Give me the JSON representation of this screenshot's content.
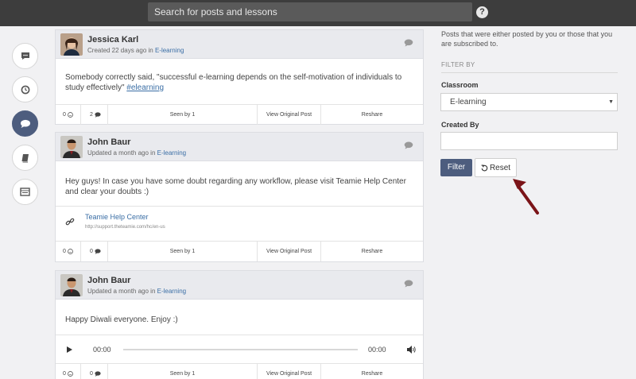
{
  "topbar": {
    "search_placeholder": "Search for posts and lessons",
    "help": "?"
  },
  "rail": [
    "comments-icon",
    "clock-icon",
    "chat-bubble-icon",
    "book-icon",
    "board-icon"
  ],
  "posts": [
    {
      "author": "Jessica Karl",
      "meta_prefix": "Created 22 days ago in ",
      "classroom": "E-learning",
      "text": "Somebody correctly said, \"successful e-learning depends on the self-motivation of individuals to study effectively\" ",
      "hashtag": "#elearning",
      "smileys": "0",
      "comments": "2",
      "seen": "Seen by 1",
      "view": "View Original Post",
      "reshare": "Reshare"
    },
    {
      "author": "John Baur",
      "meta_prefix": "Updated a month ago in ",
      "classroom": "E-learning",
      "text": "Hey guys! In case you have some doubt regarding any workflow, please visit Teamie Help Center and clear your doubts :)",
      "link_title": "Teamie Help Center",
      "link_url": "http://support.theteamie.com/hc/en-us",
      "smileys": "0",
      "comments": "0",
      "seen": "Seen by 1",
      "view": "View Original Post",
      "reshare": "Reshare"
    },
    {
      "author": "John Baur",
      "meta_prefix": "Updated a month ago in ",
      "classroom": "E-learning",
      "text": "Happy Diwali everyone. Enjoy :)",
      "audio_current": "00:00",
      "audio_total": "00:00",
      "smileys": "0",
      "comments": "0",
      "seen": "Seen by 1",
      "view": "View Original Post",
      "reshare": "Reshare"
    }
  ],
  "filter_panel": {
    "description": "Posts that were either posted by you or those that you are subscribed to.",
    "filter_by": "FILTER BY",
    "classroom_label": "Classroom",
    "classroom_value": "E-learning",
    "created_by_label": "Created By",
    "created_by_value": "",
    "filter_button": "Filter",
    "reset_button": "Reset"
  },
  "colors": {
    "accent": "#4d5d7e",
    "link": "#3a6ea5",
    "arrow": "#7b1418",
    "topbar": "#3d3d3d"
  }
}
